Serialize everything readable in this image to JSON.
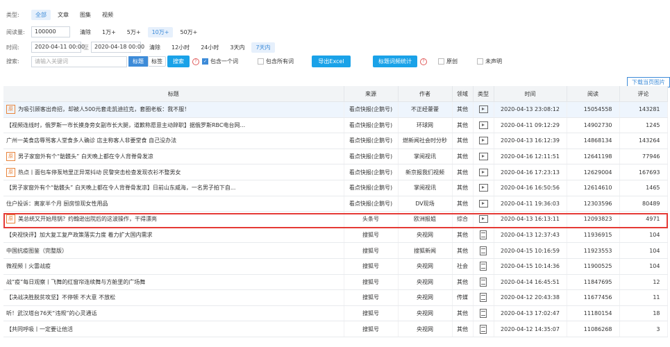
{
  "filters": {
    "type": {
      "label": "类型:",
      "options": [
        "全部",
        "文章",
        "图集",
        "视频"
      ],
      "active": 0
    },
    "reads": {
      "label": "阅读量:",
      "value": "100000",
      "clear": "清除",
      "options": [
        "1万+",
        "5万+",
        "10万+",
        "50万+"
      ],
      "active": 2
    },
    "time": {
      "label": "时间:",
      "start": "2020-04-11 00:00",
      "sep": "至",
      "end": "2020-04-18 00:00",
      "clear": "清除",
      "options": [
        "12小时",
        "24小时",
        "3天内",
        "7天内"
      ],
      "active": 3
    },
    "search": {
      "label": "搜索:",
      "placeholder": "请输入关键词",
      "mode_title": "标题",
      "mode_tag": "标签",
      "search_btn": "搜索",
      "include_one": "包含一个词",
      "include_all": "包含所有词",
      "export": "导出Excel",
      "title_stats": "标题词频统计",
      "original": "原创",
      "undeclared": "未声明"
    }
  },
  "download_label": "下载当页图片",
  "table": {
    "headers": [
      "标题",
      "来源",
      "作者",
      "领域",
      "类型",
      "时间",
      "阅读",
      "评论"
    ],
    "rows": [
      {
        "yuan": true,
        "title": "为吸引顾客出奇招，却被人500元套走凯迪拉克，套圈老板：我不服！",
        "source": "看点快报(企鹅号)",
        "author": "不正经藿藿",
        "field": "其他",
        "type": "video",
        "time": "2020-04-13 23:08:12",
        "reads": "15054558",
        "comments": "143281"
      },
      {
        "yuan": false,
        "title": "【视频连线时，俄罗斯一市长摸身旁女副市长大腿，道歉称愿意主动辞职】据俄罗斯RBC电台网...",
        "source": "看点快报(企鹅号)",
        "author": "环球网",
        "field": "其他",
        "type": "video",
        "time": "2020-04-11 09:12:29",
        "reads": "14902730",
        "comments": "1245"
      },
      {
        "yuan": false,
        "title": "广州一美食店辱骂客人堂食多人确诊 店主称客人非要堂食 自己没办法",
        "source": "看点快报(企鹅号)",
        "author": "燃新闻社会时分秒",
        "field": "其他",
        "type": "video",
        "time": "2020-04-13 16:12:39",
        "reads": "14868134",
        "comments": "143264"
      },
      {
        "yuan": true,
        "title": "男子家窗外有个“骷髅头” 白天晚上都在令人背脊骨发凉",
        "source": "看点快报(企鹅号)",
        "author": "掌阅视讯",
        "field": "其他",
        "type": "video",
        "time": "2020-04-16 12:11:51",
        "reads": "12641198",
        "comments": "77946"
      },
      {
        "yuan": true,
        "title": "热点丨面包车停泵地里正异常抖动 民警突击检查发现衣衫不整男女",
        "source": "看点快报(企鹅号)",
        "author": "新京报我们视频",
        "field": "其他",
        "type": "video",
        "time": "2020-04-16 17:23:13",
        "reads": "12629004",
        "comments": "167693"
      },
      {
        "yuan": false,
        "title": "【男子家窗外有个“骷髅头” 白天晚上都在令人背脊骨发凉】日前山东威海，一名男子拍下自...",
        "source": "看点快报(企鹅号)",
        "author": "掌阅视讯",
        "field": "其他",
        "type": "video",
        "time": "2020-04-16 16:50:56",
        "reads": "12614610",
        "comments": "1465"
      },
      {
        "yuan": false,
        "title": "住户投诉：离家半个月 厨房惊现女性用品",
        "source": "看点快报(企鹅号)",
        "author": "DV现场",
        "field": "其他",
        "type": "video",
        "time": "2020-04-11 19:36:03",
        "reads": "12303596",
        "comments": "80489"
      },
      {
        "yuan": true,
        "title": "美总统又开始甩锅？约翰逊出院后的这波操作，干得漂亮",
        "source": "头条号",
        "author": "欧洲报姐",
        "field": "综合",
        "type": "video",
        "time": "2020-04-13 16:13:11",
        "reads": "12093823",
        "comments": "4971"
      },
      {
        "yuan": false,
        "title": "【央视快评】加大复工复产政策落实力度 着力扩大国内需求",
        "source": "搜狐号",
        "author": "央视网",
        "field": "其他",
        "type": "article",
        "time": "2020-04-13 12:37:43",
        "reads": "11936915",
        "comments": "104"
      },
      {
        "yuan": false,
        "title": "中国抗疫图鉴（完整版）",
        "source": "搜狐号",
        "author": "搜狐新闻",
        "field": "其他",
        "type": "article",
        "time": "2020-04-15 10:16:59",
        "reads": "11923553",
        "comments": "104"
      },
      {
        "yuan": false,
        "title": "微视频丨火雷战疫",
        "source": "搜狐号",
        "author": "央视网",
        "field": "社会",
        "type": "article",
        "time": "2020-04-15 10:14:36",
        "reads": "11900525",
        "comments": "104"
      },
      {
        "yuan": false,
        "title": "战“疫”每日观察丨飞舞的红窗帘连续舞与方舱里的广场舞",
        "source": "搜狐号",
        "author": "央视网",
        "field": "其他",
        "type": "article",
        "time": "2020-04-14 16:45:51",
        "reads": "11847695",
        "comments": "12"
      },
      {
        "yuan": false,
        "title": "【决战决胜脱贫攻坚】不停顿 不大意 不放松",
        "source": "搜狐号",
        "author": "央视网",
        "field": "传媒",
        "type": "article",
        "time": "2020-04-12 20:43:38",
        "reads": "11677456",
        "comments": "11"
      },
      {
        "yuan": false,
        "title": "听！武汉塔台76天“违规”的心灵通话",
        "source": "搜狐号",
        "author": "央视网",
        "field": "其他",
        "type": "article",
        "time": "2020-04-13 17:02:47",
        "reads": "11180154",
        "comments": "18"
      },
      {
        "yuan": false,
        "title": "【共同呼吸丨一定要让他活",
        "source": "搜狐号",
        "author": "央视网",
        "field": "其他",
        "type": "article",
        "time": "2020-04-12 14:35:07",
        "reads": "11086268",
        "comments": "3"
      }
    ]
  }
}
